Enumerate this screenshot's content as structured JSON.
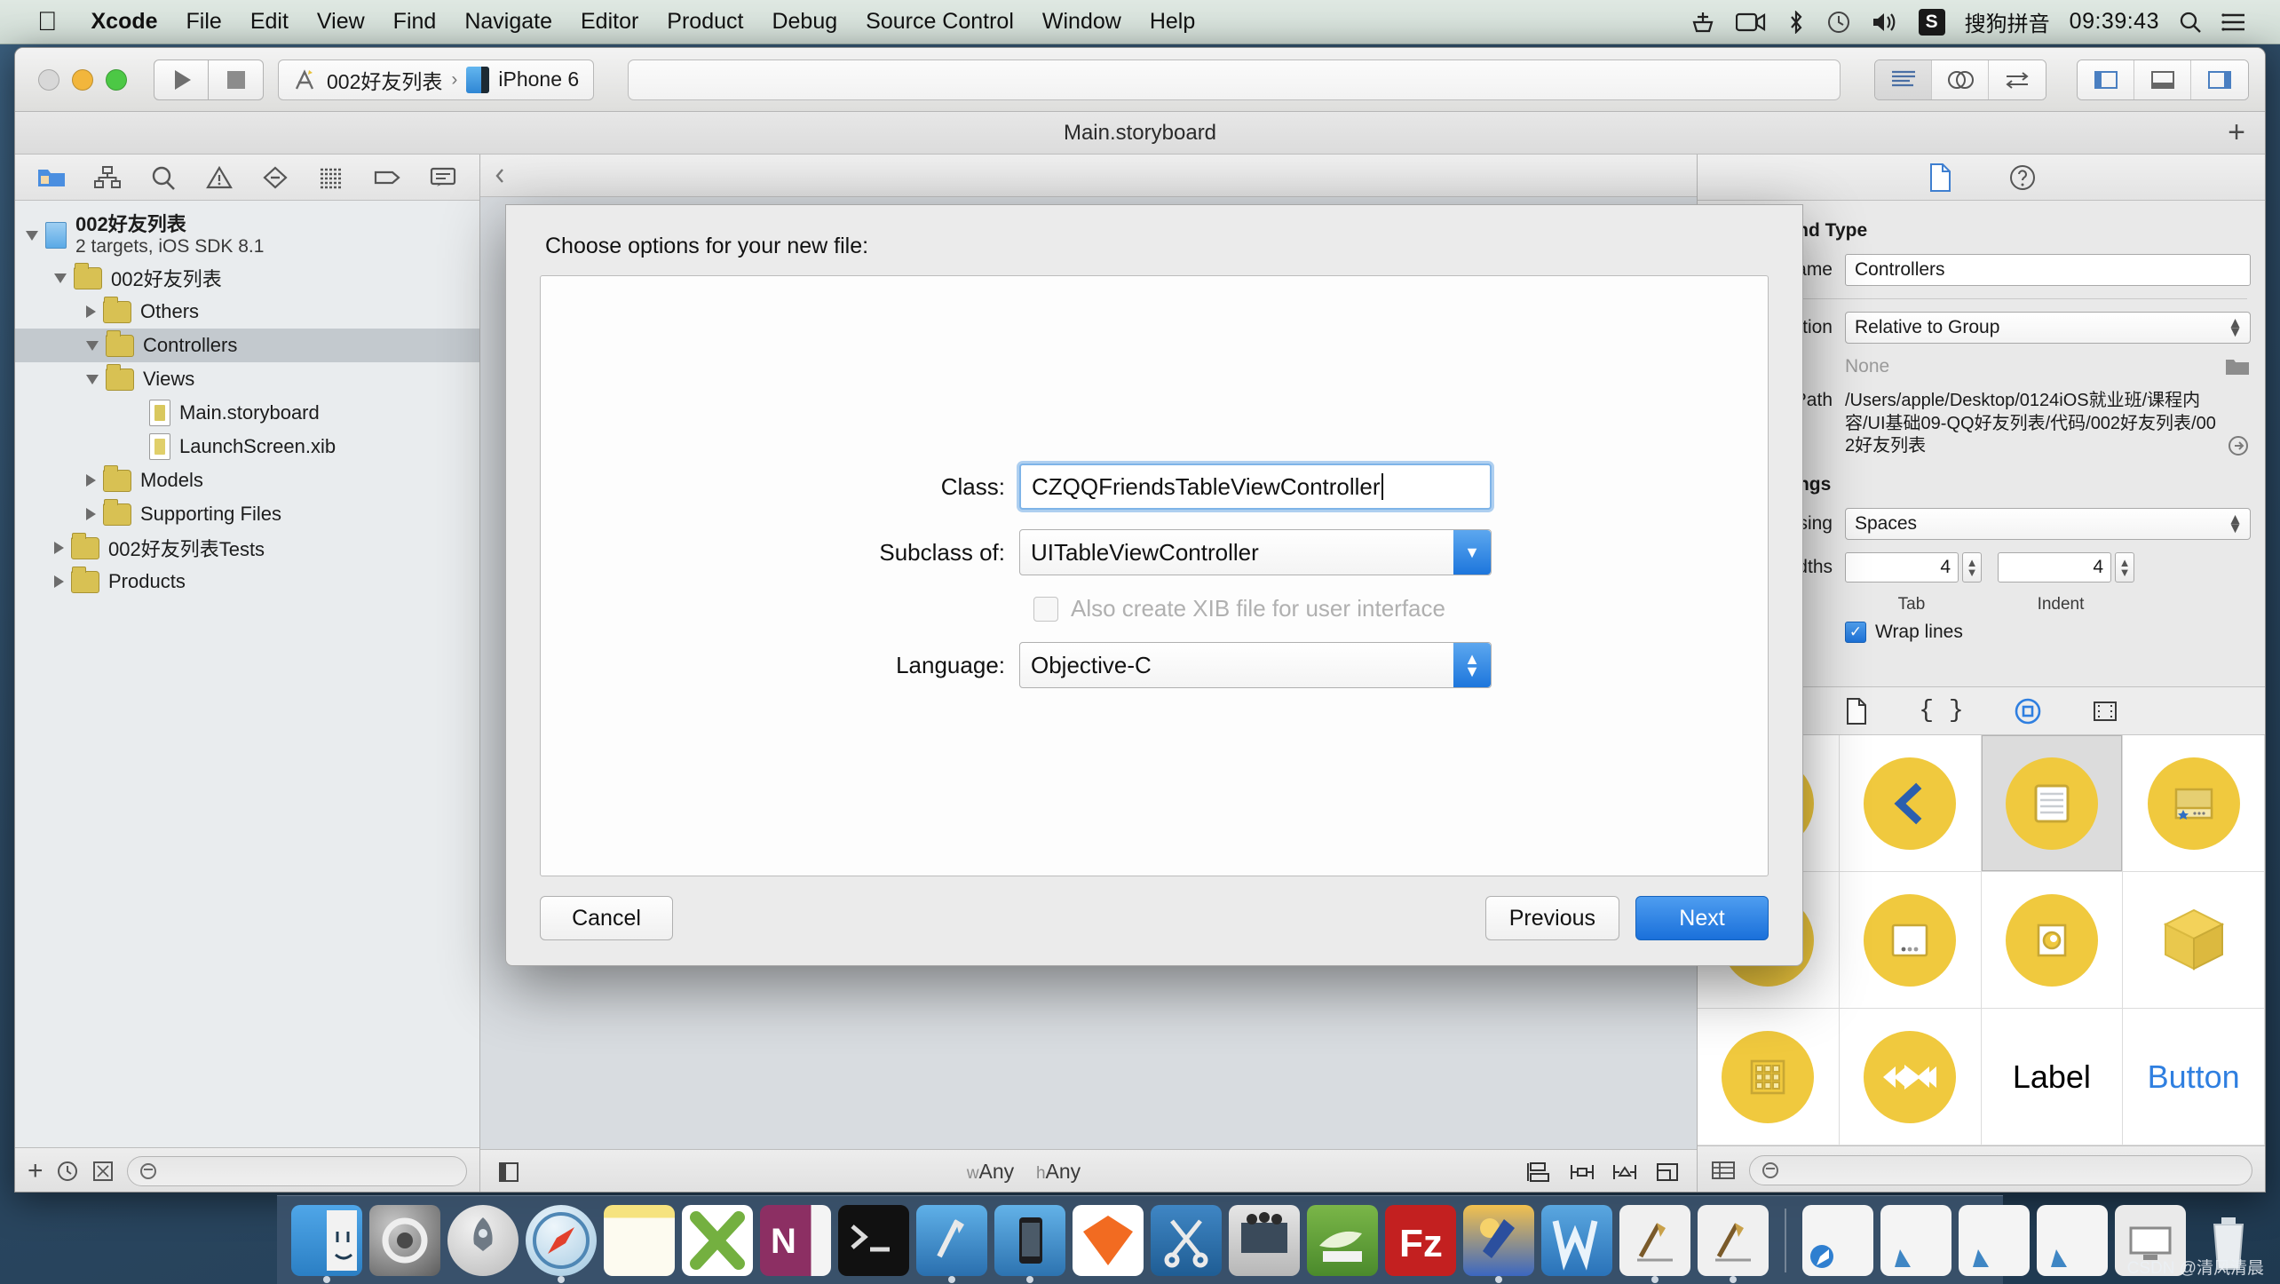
{
  "menubar": {
    "apple_icon": "apple-logo-icon",
    "items": [
      {
        "label": "Xcode",
        "bold": true
      },
      {
        "label": "File",
        "bold": false
      },
      {
        "label": "Edit",
        "bold": false
      },
      {
        "label": "View",
        "bold": false
      },
      {
        "label": "Find",
        "bold": false
      },
      {
        "label": "Navigate",
        "bold": false
      },
      {
        "label": "Editor",
        "bold": false
      },
      {
        "label": "Product",
        "bold": false
      },
      {
        "label": "Debug",
        "bold": false
      },
      {
        "label": "Source Control",
        "bold": false
      },
      {
        "label": "Window",
        "bold": false
      },
      {
        "label": "Help",
        "bold": false
      }
    ],
    "status": {
      "ime_badge": "S",
      "ime_label": "搜狗拼音",
      "clock": "09:39:43",
      "icons": [
        "plug-icon",
        "screen-record-icon",
        "bluetooth-icon",
        "time-machine-icon",
        "volume-icon",
        "spotlight-search-icon",
        "notification-center-icon"
      ]
    }
  },
  "toolbar": {
    "run_icon": "run-play-icon",
    "stop_icon": "stop-square-icon",
    "scheme_project": "002好友列表",
    "scheme_separator": "›",
    "scheme_destination": "iPhone 6",
    "activity_placeholder": "",
    "editor_segments": [
      "standard-editor-icon",
      "assistant-editor-icon",
      "version-editor-icon"
    ],
    "view_segments": [
      "toggle-navigator-icon",
      "toggle-debug-area-icon",
      "toggle-utilities-icon"
    ]
  },
  "window": {
    "title": "Main.storyboard",
    "add_icon": "+"
  },
  "navigator": {
    "tabs": [
      "project-navigator-icon",
      "symbol-navigator-icon",
      "find-navigator-icon",
      "issue-navigator-icon",
      "test-navigator-icon",
      "debug-navigator-icon",
      "breakpoint-navigator-icon",
      "report-navigator-icon"
    ],
    "tree": [
      {
        "indent": 0,
        "twisty": "open",
        "icon": "project-file-icon",
        "label": "002好友列表",
        "sublabel": "2 targets, iOS SDK 8.1",
        "selected": false
      },
      {
        "indent": 1,
        "twisty": "open",
        "icon": "folder-icon",
        "label": "002好友列表",
        "selected": false
      },
      {
        "indent": 2,
        "twisty": "closed",
        "icon": "folder-icon",
        "label": "Others",
        "selected": false
      },
      {
        "indent": 2,
        "twisty": "open",
        "icon": "folder-icon",
        "label": "Controllers",
        "selected": true
      },
      {
        "indent": 2,
        "twisty": "open",
        "icon": "folder-icon",
        "label": "Views",
        "selected": false
      },
      {
        "indent": 3,
        "twisty": "none",
        "icon": "storyboard-file-icon",
        "label": "Main.storyboard",
        "selected": false
      },
      {
        "indent": 3,
        "twisty": "none",
        "icon": "xib-file-icon",
        "label": "LaunchScreen.xib",
        "selected": false
      },
      {
        "indent": 2,
        "twisty": "closed",
        "icon": "folder-icon",
        "label": "Models",
        "selected": false
      },
      {
        "indent": 2,
        "twisty": "closed",
        "icon": "folder-icon",
        "label": "Supporting Files",
        "selected": false
      },
      {
        "indent": 1,
        "twisty": "closed",
        "icon": "folder-icon",
        "label": "002好友列表Tests",
        "selected": false
      },
      {
        "indent": 1,
        "twisty": "closed",
        "icon": "folder-icon",
        "label": "Products",
        "selected": false
      }
    ],
    "footer": {
      "add_icon": "+",
      "recent_icon": "clock-filter-icon",
      "source_control_icon": "source-control-filter-icon",
      "filter_placeholder": ""
    }
  },
  "editor": {
    "footer_left_icon": "toggle-document-outline-icon",
    "size_class_w": "wAny",
    "size_class_h": "hAny",
    "size_class_w_prefix": "w",
    "size_class_h_prefix": "h",
    "constraint_icons": [
      "align-icon",
      "pin-icon",
      "resolve-issues-icon",
      "embed-icon"
    ]
  },
  "inspector": {
    "tabs": [
      "file-inspector-icon",
      "quick-help-icon"
    ],
    "identity": {
      "section_title": "Identity and Type",
      "name_label": "Name",
      "name_value": "Controllers",
      "location_label": "Location",
      "location_value": "Relative to Group",
      "location_none": "None",
      "folder_icon": "choose-folder-icon",
      "full_path_label": "Full Path",
      "full_path_value": "/Users/apple/Desktop/0124iOS就业班/课程内容/UI基础09-QQ好友列表/代码/002好友列表/002好友列表",
      "reveal_icon": "reveal-in-finder-icon"
    },
    "text_settings": {
      "section_title": "Text Settings",
      "indent_using_label": "Indent Using",
      "indent_using_value": "Spaces",
      "widths_label": "Widths",
      "tab_value": "4",
      "indent_value": "4",
      "tab_caption": "Tab",
      "indent_caption": "Indent",
      "wrap_lines_label": "Wrap lines",
      "wrap_lines_checked": true
    }
  },
  "library": {
    "tabs": [
      "file-template-library-icon",
      "code-snippet-library-icon",
      "object-library-icon",
      "media-library-icon"
    ],
    "active_tab_index": 2,
    "items": [
      {
        "name": "view-controller-object",
        "kind": "circle",
        "glyph": "dashed-square",
        "selected": false
      },
      {
        "name": "navigation-controller-object",
        "kind": "circle",
        "glyph": "back-chevron",
        "selected": false
      },
      {
        "name": "table-view-controller-object",
        "kind": "circle",
        "glyph": "lined-page",
        "selected": true
      },
      {
        "name": "table-view-cell-object",
        "kind": "circle",
        "glyph": "cell-star",
        "selected": false
      },
      {
        "name": "split-view-controller-object",
        "kind": "circle",
        "glyph": "split-pane",
        "selected": false
      },
      {
        "name": "page-view-controller-object",
        "kind": "circle",
        "glyph": "page-dots",
        "selected": false
      },
      {
        "name": "collection-view-controller-object",
        "kind": "circle",
        "glyph": "circle-in-square",
        "selected": false
      },
      {
        "name": "object-cube",
        "kind": "cube",
        "glyph": "cube",
        "selected": false
      },
      {
        "name": "collection-view-object",
        "kind": "circle",
        "glyph": "grid-nine",
        "selected": false
      },
      {
        "name": "av-player-object",
        "kind": "circle",
        "glyph": "transport-play",
        "selected": false
      },
      {
        "name": "label-object",
        "kind": "text",
        "glyph": "Label",
        "selected": false
      },
      {
        "name": "button-object",
        "kind": "text-blue",
        "glyph": "Button",
        "selected": false
      }
    ],
    "footer": {
      "list_view_icon": "list-view-icon",
      "filter_placeholder": ""
    }
  },
  "sheet": {
    "title": "Choose options for your new file:",
    "class_label": "Class:",
    "class_value": "CZQQFriendsTableViewController",
    "subclass_label": "Subclass of:",
    "subclass_value": "UITableViewController",
    "xib_checkbox_label": "Also create XIB file for user interface",
    "xib_checked": false,
    "xib_disabled": true,
    "language_label": "Language:",
    "language_value": "Objective-C",
    "cancel_label": "Cancel",
    "previous_label": "Previous",
    "next_label": "Next"
  },
  "dock": {
    "items": [
      {
        "name": "finder",
        "running": true
      },
      {
        "name": "system-preferences",
        "running": false
      },
      {
        "name": "launchpad",
        "running": false
      },
      {
        "name": "safari",
        "running": true
      },
      {
        "name": "notes",
        "running": false
      },
      {
        "name": "excel",
        "running": false
      },
      {
        "name": "onenote",
        "running": false
      },
      {
        "name": "terminal",
        "running": false
      },
      {
        "name": "xcode",
        "running": true
      },
      {
        "name": "ios-simulator",
        "running": true
      },
      {
        "name": "sketch",
        "running": false
      },
      {
        "name": "snipaste",
        "running": false
      },
      {
        "name": "quicktime",
        "running": false
      },
      {
        "name": "thunder",
        "running": false
      },
      {
        "name": "filezilla",
        "running": false
      },
      {
        "name": "word",
        "running": true
      },
      {
        "name": "wps",
        "running": false
      },
      {
        "name": "xcode-alt-1",
        "running": true
      },
      {
        "name": "xcode-alt-2",
        "running": true
      }
    ],
    "minimized": [
      {
        "name": "minimized-safari-window"
      },
      {
        "name": "minimized-doc-window-1"
      },
      {
        "name": "minimized-doc-window-2"
      },
      {
        "name": "minimized-doc-window-3"
      },
      {
        "name": "minimized-screen-window"
      }
    ],
    "trash_name": "trash"
  },
  "watermark": "CSDN @清风清晨"
}
